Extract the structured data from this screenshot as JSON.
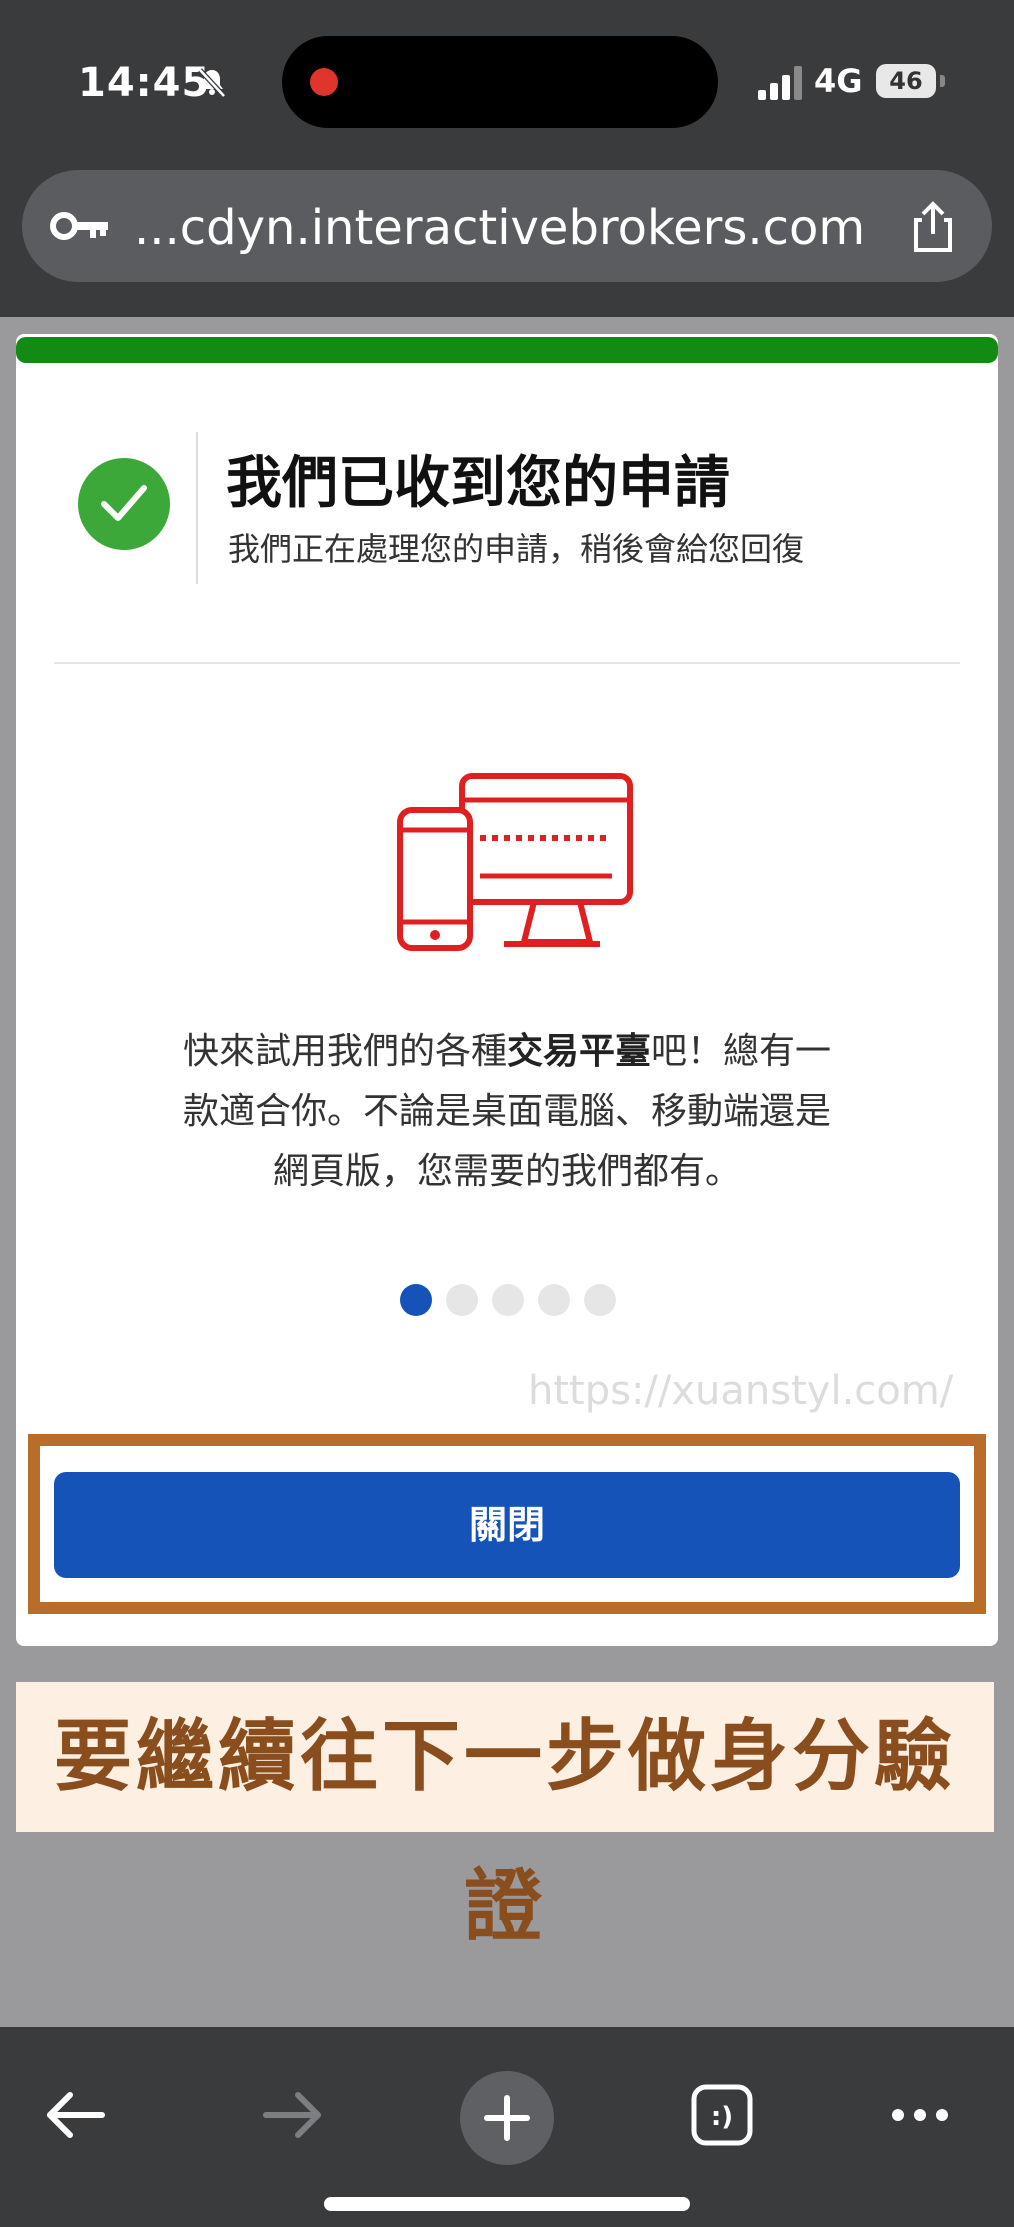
{
  "status_bar": {
    "time": "14:45",
    "network": "4G",
    "battery": "46"
  },
  "browser": {
    "url": "...cdyn.interactivebrokers.com"
  },
  "card": {
    "title": "我們已收到您的申請",
    "subtitle": "我們正在處理您的申請，稍後會給您回復",
    "promo_line1_pre": "快來試用我們的各種",
    "promo_line1_bold": "交易平臺",
    "promo_line1_post": "吧！總有一",
    "promo_line2": "款適合你。不論是桌面電腦、移動端還是",
    "promo_line3": "網頁版，您需要的我們都有。",
    "carousel_pages": 5,
    "carousel_active": 1,
    "watermark": "https://xuanstyl.com/",
    "close_label": "關閉",
    "progress": 1.0
  },
  "banner": {
    "text": "要繼續往下一步做身分驗證"
  },
  "colors": {
    "progress": "#138a14",
    "primary_button": "#1553b9",
    "check": "#3da83a",
    "highlight_frame": "#b86d2a",
    "icon_red": "#e02020"
  },
  "icons": [
    "bell-off-icon",
    "signal-icon",
    "battery-icon",
    "key-icon",
    "share-icon",
    "check-icon",
    "devices-icon",
    "back-arrow-icon",
    "forward-arrow-icon",
    "new-tab-icon",
    "tabs-icon",
    "more-icon"
  ]
}
